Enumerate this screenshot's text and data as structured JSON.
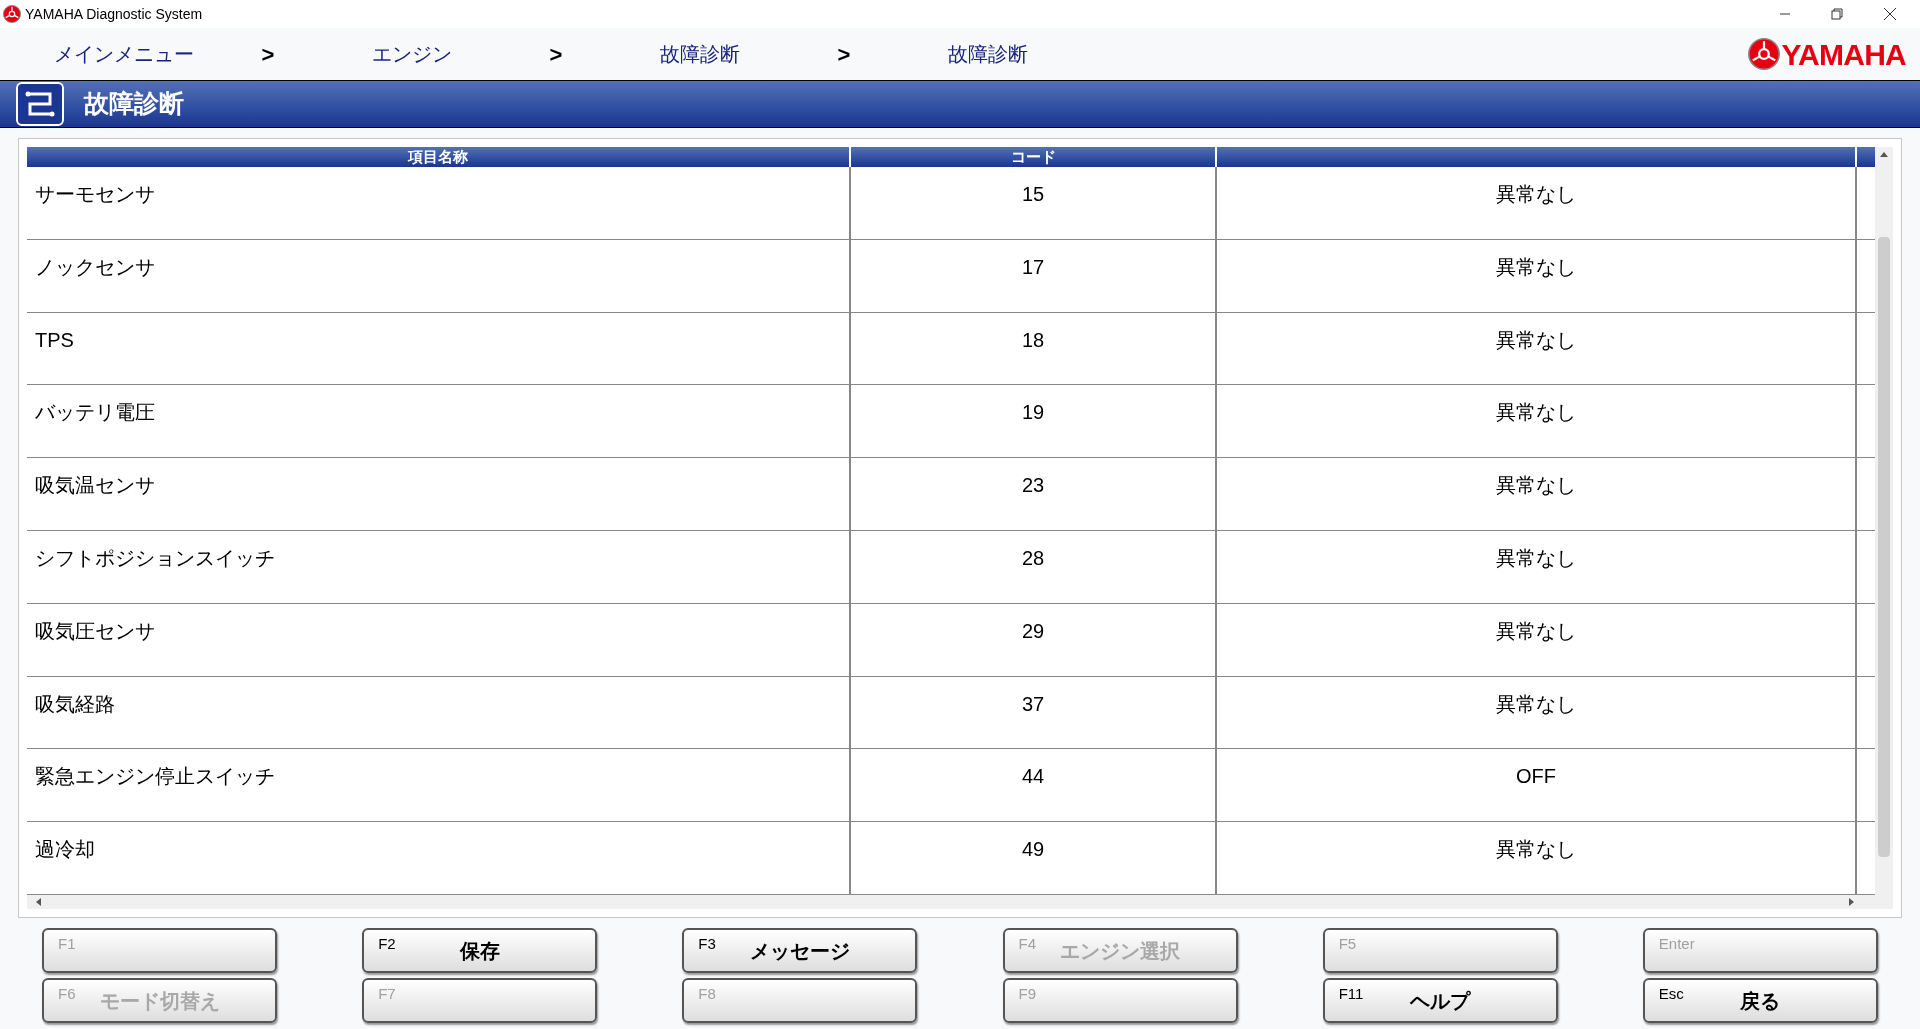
{
  "window": {
    "title": "YAMAHA Diagnostic System"
  },
  "breadcrumb": [
    {
      "label": "メインメニュー",
      "separator": ">"
    },
    {
      "label": "エンジン",
      "separator": ">"
    },
    {
      "label": "故障診断",
      "separator": ">"
    },
    {
      "label": "故障診断"
    }
  ],
  "brand": "YAMAHA",
  "page_title": "故障診断",
  "table": {
    "columns": [
      "項目名称",
      "コード"
    ],
    "rows": [
      {
        "name": "サーモセンサ",
        "code": "15",
        "result": "異常なし"
      },
      {
        "name": "ノックセンサ",
        "code": "17",
        "result": "異常なし"
      },
      {
        "name": "TPS",
        "code": "18",
        "result": "異常なし"
      },
      {
        "name": "バッテリ電圧",
        "code": "19",
        "result": "異常なし"
      },
      {
        "name": "吸気温センサ",
        "code": "23",
        "result": "異常なし"
      },
      {
        "name": "シフトポジションスイッチ",
        "code": "28",
        "result": "異常なし"
      },
      {
        "name": "吸気圧センサ",
        "code": "29",
        "result": "異常なし"
      },
      {
        "name": "吸気経路",
        "code": "37",
        "result": "異常なし"
      },
      {
        "name": "緊急エンジン停止スイッチ",
        "code": "44",
        "result": "OFF"
      },
      {
        "name": "過冷却",
        "code": "49",
        "result": "異常なし"
      }
    ]
  },
  "function_keys": [
    {
      "key": "F1",
      "disabled": true
    },
    {
      "key": "F2",
      "label": "保存",
      "disabled": false
    },
    {
      "key": "F3",
      "label": "メッセージ",
      "disabled": false
    },
    {
      "key": "F4",
      "label": "エンジン選択",
      "disabled": true
    },
    {
      "key": "F5",
      "disabled": true
    },
    {
      "key": "Enter",
      "disabled": true
    },
    {
      "key": "F6",
      "label": "モード切替え",
      "disabled": true
    },
    {
      "key": "F7",
      "disabled": true
    },
    {
      "key": "F8",
      "disabled": true
    },
    {
      "key": "F9",
      "disabled": true
    },
    {
      "key": "F11",
      "label": "ヘルプ",
      "disabled": false
    },
    {
      "key": "Esc",
      "label": "戻る",
      "disabled": false
    }
  ]
}
